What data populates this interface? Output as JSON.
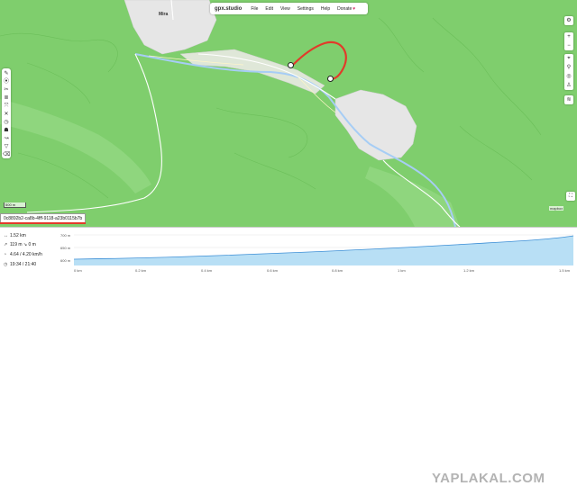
{
  "app": {
    "logo": "gpx.studio",
    "menu": [
      "File",
      "Edit",
      "View",
      "Settings",
      "Help"
    ],
    "donate": "Donate"
  },
  "map": {
    "town_label": "Mira",
    "scale_label": "500 m",
    "attribution": "mapbox",
    "track_color": "#e23a2a"
  },
  "file_tab": {
    "label": "0c8892b2-ca8b-4fff-9118-a23b0115b7b"
  },
  "stats": {
    "distance": "1.52 km",
    "elevation": "119 m ↘ 0 m",
    "speed": "4.64 / 4.20 km/h",
    "time": "19:34 / 21:40"
  },
  "profile": {
    "y_ticks": [
      "700 m",
      "650 m",
      "600 m"
    ],
    "x_ticks": [
      "0 km",
      "0.2 km",
      "0.4 km",
      "0.6 km",
      "0.8 km",
      "1 km",
      "1.2 km",
      "1.5 km"
    ],
    "fill_color": "#b8dff5",
    "line_color": "#3d8fd6"
  },
  "watermark": "YAPLAKAL.COM"
}
